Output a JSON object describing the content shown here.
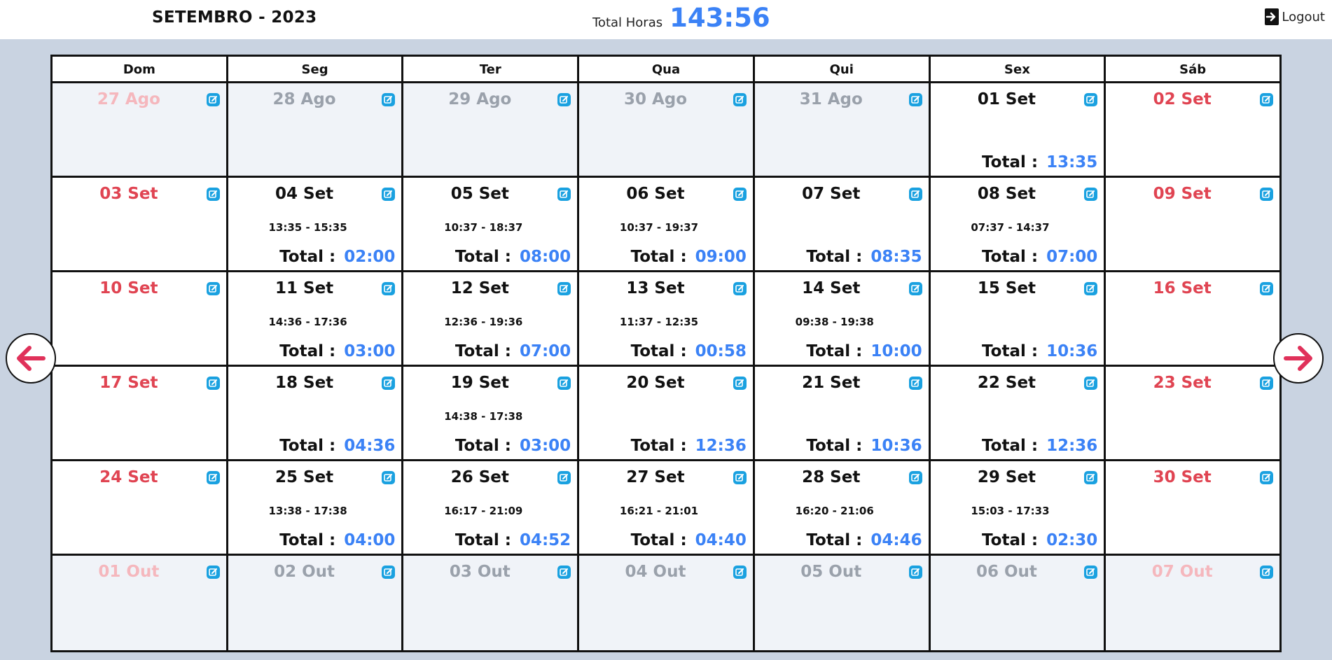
{
  "header": {
    "month_title": "SETEMBRO - 2023",
    "total_label": "Total Horas",
    "total_value": "143:56",
    "logout_label": "Logout"
  },
  "colors": {
    "accent": "#3b82f6",
    "weekend": "#e04452",
    "edit_icon": "#1aa1e0",
    "nav_arrow": "#e0315a",
    "background": "#c9d3e1"
  },
  "weekdays": [
    "Dom",
    "Seg",
    "Ter",
    "Qua",
    "Qui",
    "Sex",
    "Sáb"
  ],
  "total_prefix": "Total :",
  "weeks": [
    [
      {
        "date": "27 Ago",
        "state": "muted-weekend"
      },
      {
        "date": "28 Ago",
        "state": "muted"
      },
      {
        "date": "29 Ago",
        "state": "muted"
      },
      {
        "date": "30 Ago",
        "state": "muted"
      },
      {
        "date": "31 Ago",
        "state": "muted"
      },
      {
        "date": "01 Set",
        "state": "normal",
        "total": "13:35"
      },
      {
        "date": "02 Set",
        "state": "weekend"
      }
    ],
    [
      {
        "date": "03 Set",
        "state": "weekend"
      },
      {
        "date": "04 Set",
        "state": "normal",
        "range": "13:35 - 15:35",
        "total": "02:00"
      },
      {
        "date": "05 Set",
        "state": "normal",
        "range": "10:37 - 18:37",
        "total": "08:00"
      },
      {
        "date": "06 Set",
        "state": "normal",
        "range": "10:37 - 19:37",
        "total": "09:00"
      },
      {
        "date": "07 Set",
        "state": "normal",
        "total": "08:35"
      },
      {
        "date": "08 Set",
        "state": "normal",
        "range": "07:37 - 14:37",
        "total": "07:00"
      },
      {
        "date": "09 Set",
        "state": "weekend"
      }
    ],
    [
      {
        "date": "10 Set",
        "state": "weekend"
      },
      {
        "date": "11 Set",
        "state": "normal",
        "range": "14:36 - 17:36",
        "total": "03:00"
      },
      {
        "date": "12 Set",
        "state": "normal",
        "range": "12:36 - 19:36",
        "total": "07:00"
      },
      {
        "date": "13 Set",
        "state": "normal",
        "range": "11:37 - 12:35",
        "total": "00:58"
      },
      {
        "date": "14 Set",
        "state": "normal",
        "range": "09:38 - 19:38",
        "total": "10:00"
      },
      {
        "date": "15 Set",
        "state": "normal",
        "total": "10:36"
      },
      {
        "date": "16 Set",
        "state": "weekend"
      }
    ],
    [
      {
        "date": "17 Set",
        "state": "weekend"
      },
      {
        "date": "18 Set",
        "state": "normal",
        "total": "04:36"
      },
      {
        "date": "19 Set",
        "state": "normal",
        "range": "14:38 - 17:38",
        "total": "03:00"
      },
      {
        "date": "20 Set",
        "state": "normal",
        "total": "12:36"
      },
      {
        "date": "21 Set",
        "state": "normal",
        "total": "10:36"
      },
      {
        "date": "22 Set",
        "state": "normal",
        "total": "12:36"
      },
      {
        "date": "23 Set",
        "state": "weekend"
      }
    ],
    [
      {
        "date": "24 Set",
        "state": "weekend"
      },
      {
        "date": "25 Set",
        "state": "normal",
        "range": "13:38 - 17:38",
        "total": "04:00"
      },
      {
        "date": "26 Set",
        "state": "normal",
        "range": "16:17 - 21:09",
        "total": "04:52"
      },
      {
        "date": "27 Set",
        "state": "normal",
        "range": "16:21 - 21:01",
        "total": "04:40"
      },
      {
        "date": "28 Set",
        "state": "normal",
        "range": "16:20 - 21:06",
        "total": "04:46"
      },
      {
        "date": "29 Set",
        "state": "normal",
        "range": "15:03 - 17:33",
        "total": "02:30"
      },
      {
        "date": "30 Set",
        "state": "weekend"
      }
    ],
    [
      {
        "date": "01 Out",
        "state": "muted-weekend"
      },
      {
        "date": "02 Out",
        "state": "muted"
      },
      {
        "date": "03 Out",
        "state": "muted"
      },
      {
        "date": "04 Out",
        "state": "muted"
      },
      {
        "date": "05 Out",
        "state": "muted"
      },
      {
        "date": "06 Out",
        "state": "muted"
      },
      {
        "date": "07 Out",
        "state": "muted-weekend"
      }
    ]
  ],
  "icons": {
    "edit": "edit-icon",
    "prev": "arrow-left-icon",
    "next": "arrow-right-icon",
    "logout": "logout-icon"
  }
}
